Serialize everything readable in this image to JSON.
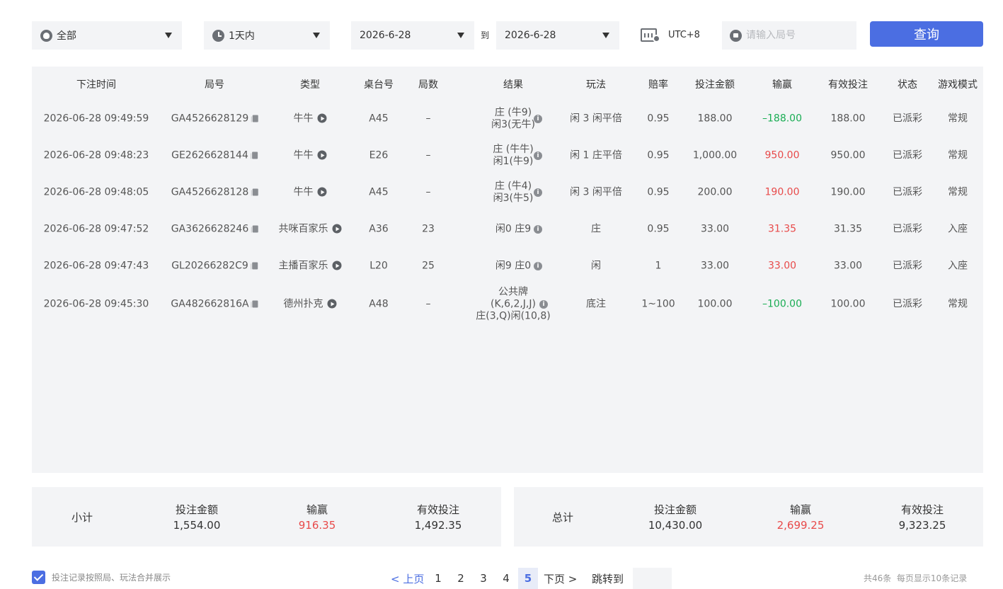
{
  "filters": {
    "game_select": "全部",
    "time_select": "1天内",
    "date_from": "2026-6-28",
    "date_to": "2026-6-28",
    "to_label": "到",
    "timezone": "UTC+8",
    "round_search_placeholder": "请输入局号",
    "query_button": "查询"
  },
  "table": {
    "headers": [
      "下注时间",
      "局号",
      "类型",
      "桌台号",
      "局数",
      "结果",
      "玩法",
      "赔率",
      "投注金额",
      "输赢",
      "有效投注",
      "状态",
      "游戏模式"
    ],
    "rows": [
      {
        "time": "2026-06-28 09:49:59",
        "round": "GA4526628129",
        "type": "牛牛",
        "table": "A45",
        "count": "–",
        "result": [
          "庄 (牛9)",
          "闲3(无牛)"
        ],
        "play": "闲 3 闲平倍",
        "odds": "0.95",
        "bet": "188.00",
        "winloss": "–188.00",
        "winloss_sign": "neg",
        "valid": "188.00",
        "status": "已派彩",
        "mode": "常规"
      },
      {
        "time": "2026-06-28 09:48:23",
        "round": "GE2626628144",
        "type": "牛牛",
        "table": "E26",
        "count": "–",
        "result": [
          "庄 (牛牛)",
          "闲1(牛9)"
        ],
        "play": "闲 1 庄平倍",
        "odds": "0.95",
        "bet": "1,000.00",
        "winloss": "950.00",
        "winloss_sign": "pos",
        "valid": "950.00",
        "status": "已派彩",
        "mode": "常规"
      },
      {
        "time": "2026-06-28 09:48:05",
        "round": "GA4526628128",
        "type": "牛牛",
        "table": "A45",
        "count": "–",
        "result": [
          "庄 (牛4)",
          "闲3(牛5)"
        ],
        "play": "闲 3 闲平倍",
        "odds": "0.95",
        "bet": "200.00",
        "winloss": "190.00",
        "winloss_sign": "pos",
        "valid": "190.00",
        "status": "已派彩",
        "mode": "常规"
      },
      {
        "time": "2026-06-28 09:47:52",
        "round": "GA3626628246",
        "type": "共咪百家乐",
        "table": "A36",
        "count": "23",
        "result": [
          "闲0 庄9"
        ],
        "play": "庄",
        "odds": "0.95",
        "bet": "33.00",
        "winloss": "31.35",
        "winloss_sign": "pos",
        "valid": "31.35",
        "status": "已派彩",
        "mode": "入座"
      },
      {
        "time": "2026-06-28 09:47:43",
        "round": "GL20266282C9",
        "type": "主播百家乐",
        "table": "L20",
        "count": "25",
        "result": [
          "闲9 庄0"
        ],
        "play": "闲",
        "odds": "1",
        "bet": "33.00",
        "winloss": "33.00",
        "winloss_sign": "pos",
        "valid": "33.00",
        "status": "已派彩",
        "mode": "入座"
      },
      {
        "time": "2026-06-28 09:45:30",
        "round": "GA482662816A",
        "type": "德州扑克",
        "table": "A48",
        "count": "–",
        "result": [
          "公共牌",
          "(K,6,2,J,J)",
          "庄(3,Q)闲(10,8)"
        ],
        "play": "底注",
        "odds": "1~100",
        "bet": "100.00",
        "winloss": "–100.00",
        "winloss_sign": "neg",
        "valid": "100.00",
        "status": "已派彩",
        "mode": "常规"
      }
    ]
  },
  "subtotal": {
    "label": "小计",
    "bet_label": "投注金额",
    "bet": "1,554.00",
    "winloss_label": "输赢",
    "winloss": "916.35",
    "valid_label": "有效投注",
    "valid": "1,492.35"
  },
  "total": {
    "label": "总计",
    "bet_label": "投注金额",
    "bet": "10,430.00",
    "winloss_label": "输赢",
    "winloss": "2,699.25",
    "valid_label": "有效投注",
    "valid": "9,323.25"
  },
  "footer": {
    "merge_checkbox_label": "投注记录按照局、玩法合并展示",
    "merge_checked": true,
    "prev": "< 上页",
    "pages": [
      "1",
      "2",
      "3",
      "4",
      "5"
    ],
    "current_page": "5",
    "next": "下页 >",
    "jump_label": "跳转到",
    "total_count": "共46条",
    "per_page": "每页显示10条记录"
  },
  "colors": {
    "accent": "#4b6ee2",
    "positive": "#e84a4a",
    "negative": "#1aad54",
    "panel": "#f3f4f6"
  },
  "icons": {
    "game_select": "spade-icon",
    "time_select": "clock-icon",
    "timezone": "calendar-icon",
    "round_search": "chat-icon",
    "round": "copy-icon",
    "type": "play-icon",
    "result": "info-icon"
  }
}
